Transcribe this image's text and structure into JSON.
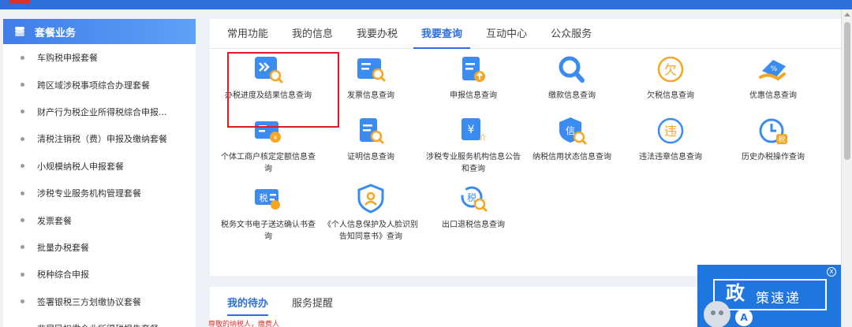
{
  "sidebar": {
    "title": "套餐业务",
    "items": [
      {
        "label": "车购税申报套餐"
      },
      {
        "label": "跨区域涉税事项综合办理套餐"
      },
      {
        "label": "财产行为税企业所得税综合申报..."
      },
      {
        "label": "清税注销税（费）申报及缴纳套餐"
      },
      {
        "label": "小规模纳税人申报套餐"
      },
      {
        "label": "涉税专业服务机构管理套餐"
      },
      {
        "label": "发票套餐"
      },
      {
        "label": "批量办税套餐"
      },
      {
        "label": "税种综合申报"
      },
      {
        "label": "签署银税三方划缴协议套餐"
      },
      {
        "label": "非居民扣缴企业所得税报告套餐"
      }
    ]
  },
  "main": {
    "tabs": [
      {
        "label": "常用功能"
      },
      {
        "label": "我的信息"
      },
      {
        "label": "我要办税"
      },
      {
        "label": "我要查询"
      },
      {
        "label": "互动中心"
      },
      {
        "label": "公众服务"
      }
    ],
    "active_tab": "我要查询",
    "grid": [
      {
        "label": "办税进度及结果信息查询",
        "icon": "progress-query-icon"
      },
      {
        "label": "发票信息查询",
        "icon": "invoice-query-icon"
      },
      {
        "label": "申报信息查询",
        "icon": "declaration-query-icon"
      },
      {
        "label": "缴款信息查询",
        "icon": "payment-query-icon"
      },
      {
        "label": "欠税信息查询",
        "icon": "tax-owed-icon"
      },
      {
        "label": "优惠信息查询",
        "icon": "discount-icon"
      },
      {
        "label": "个体工商户核定定额信息查询",
        "icon": "business-quota-icon"
      },
      {
        "label": "证明信息查询",
        "icon": "certificate-query-icon"
      },
      {
        "label": "涉税专业服务机构信息公告和查询",
        "icon": "service-agency-icon"
      },
      {
        "label": "纳税信用状态信息查询",
        "icon": "credit-status-icon"
      },
      {
        "label": "违法违章信息查询",
        "icon": "violation-icon"
      },
      {
        "label": "历史办税操作查询",
        "icon": "history-icon"
      },
      {
        "label": "税务文书电子送达确认书查询",
        "icon": "tax-document-icon"
      },
      {
        "label": "《个人信息保护及人脸识别告知同意书》查询",
        "icon": "privacy-shield-icon"
      },
      {
        "label": "出口退税信息查询",
        "icon": "export-refund-icon"
      }
    ]
  },
  "bottom": {
    "tabs": [
      {
        "label": "我的待办"
      },
      {
        "label": "服务提醒"
      }
    ],
    "greeting": "尊敬的纳税人，缴费人"
  },
  "policy_widget": {
    "title_main": "政",
    "title_sub": "策速递",
    "bubble": "A",
    "close": "x"
  },
  "colors": {
    "accent": "#2f6fd8",
    "icon_blue": "#3b8cf0",
    "icon_orange": "#f5a623",
    "highlight": "#e01b24"
  }
}
